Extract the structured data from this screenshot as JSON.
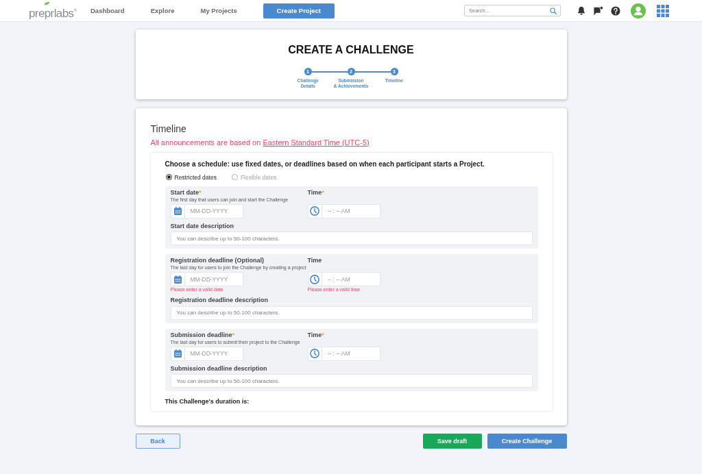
{
  "nav": {
    "logo": "preprlabs$^{®}$",
    "links": [
      {
        "label": "Dashboard"
      },
      {
        "label": "Explore"
      },
      {
        "label": "My Projects"
      }
    ],
    "create_button": "Create Project",
    "search": {
      "placeholder": "Search..."
    }
  },
  "header": {
    "title": "CREATE A CHALLENGE",
    "steps": [
      {
        "number": "1",
        "label": "Challenge\nDetails"
      },
      {
        "number": "2",
        "label": "Submission\n& Achievements"
      },
      {
        "number": "3",
        "label": "Timeline"
      }
    ]
  },
  "timeline": {
    "title": "Timeline",
    "notice": {
      "text": "All announcements are based on",
      "link": "Eastern Standard Time (UTC-5)"
    },
    "prompt": "Choose a schedule: use fixed dates, or deadlines based on when each participant starts a Project.",
    "schedule_options": [
      {
        "label": "Restricted dates",
        "selected": true,
        "disabled": false
      },
      {
        "label": "Flexible dates",
        "selected": false,
        "disabled": true
      }
    ],
    "deadlines": [
      {
        "label": "Start date",
        "required_mark": "*",
        "hint": "The first day that users can join and start the Challenge",
        "date_placeholder": "MM-DD-YYYY",
        "time_label": "Time",
        "time_required_mark": "*",
        "time_placeholder": "-- : -- AM",
        "description_label": "Start date description",
        "description_placeholder": "You can describe up to 50-100 characters."
      },
      {
        "label": "Registration deadline (Optional)",
        "hint": "The last day for users to join the Challenge by creating a project",
        "date_placeholder": "MM-DD-YYYY",
        "date_error": "Please enter a valid date",
        "time_label": "Time",
        "time_placeholder": "-- : -- AM",
        "time_error": "Please enter a valid time",
        "description_label": "Registration deadline description",
        "description_placeholder": "You can describe up to 50-100 characters."
      },
      {
        "label": "Submission deadline",
        "required_mark": "*",
        "hint": "The last day for users to submit their project to the Challenge",
        "date_placeholder": "MM-DD-YYYY",
        "time_label": "Time",
        "time_required_mark": "*",
        "time_placeholder": "-- : -- AM",
        "description_label": "Submission deadline description",
        "description_placeholder": "You can describe up to 50-100 characters."
      }
    ],
    "duration_label": "This Challenge's duration is:"
  },
  "footer": {
    "back_button": "Back",
    "save_button": "Save draft",
    "submit_button": "Create Challenge"
  }
}
